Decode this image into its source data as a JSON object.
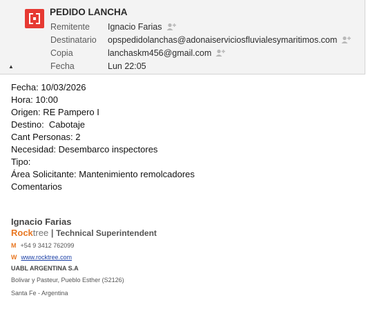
{
  "header": {
    "subject": "PEDIDO LANCHA",
    "rows": [
      {
        "label": "Remitente",
        "value": "Ignacio Farias"
      },
      {
        "label": "Destinatario",
        "value": "opspedidolanchas@adonaiserviciosfluvialesymaritimos.com"
      },
      {
        "label": "Copia",
        "value": "lanchaskm456@gmail.com"
      },
      {
        "label": "Fecha",
        "value": "Lun 22:05"
      }
    ],
    "collapse_glyph": "▲"
  },
  "body": {
    "lines": [
      "Fecha: 10/03/2026",
      "Hora: 10:00",
      "Origen: RE Pampero I",
      "Destino:  Cabotaje",
      "Cant Personas: 2",
      "Necesidad: Desembarco inspectores",
      "Tipo:",
      "Área Solicitante: Mantenimiento remolcadores",
      "Comentarios"
    ]
  },
  "signature": {
    "name": "Ignacio Farias",
    "brand_part1": "Rock",
    "brand_part2": "tree",
    "separator": "|",
    "role": "Technical Superintendent",
    "phone_key": "M",
    "phone": "+54 9 3412 762099",
    "web_key": "W",
    "web": "www.rocktree.com",
    "company": "UABL ARGENTINA S.A",
    "address1": "Bolivar y Pasteur, Pueblo Esther (S2126)",
    "address2": "Santa Fe - Argentina"
  },
  "colors": {
    "logo_red": "#e63a33",
    "brand_orange": "#e87722",
    "link_blue": "#1a3fa6",
    "header_bg": "#f3f3f3"
  },
  "icons": {
    "logo": "app-logo-icon",
    "add_contact": "add-contact-icon",
    "collapse": "collapse-up-icon"
  }
}
